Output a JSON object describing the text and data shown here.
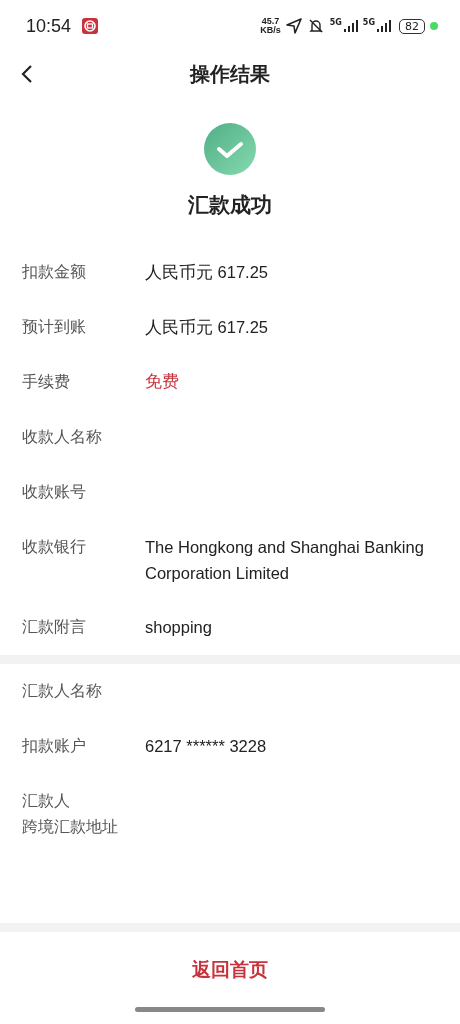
{
  "status_bar": {
    "time": "10:54",
    "speed": "45.7",
    "speed_unit": "KB/s",
    "network_1": "5G",
    "network_2": "5G",
    "battery": "82"
  },
  "nav": {
    "title": "操作结果"
  },
  "result": {
    "title": "汇款成功"
  },
  "sections": [
    {
      "rows": [
        {
          "label": "扣款金额",
          "value": "人民币元 617.25",
          "highlight": false
        },
        {
          "label": "预计到账",
          "value": "人民币元 617.25",
          "highlight": false
        },
        {
          "label": "手续费",
          "value": "免费",
          "highlight": true
        },
        {
          "label": "收款人名称"
        },
        {
          "label": "收款账号"
        },
        {
          "label": "收款银行",
          "value": "The Hongkong and Shanghai Banking Corporation Limited",
          "highlight": false
        },
        {
          "label": "汇款附言",
          "value": "shopping",
          "highlight": false
        }
      ]
    },
    {
      "rows": [
        {
          "label": "汇款人名称"
        },
        {
          "label": "扣款账户",
          "value": "6217 ****** 3228",
          "highlight": false
        },
        {
          "label": "汇款人",
          "label_2": "跨境汇款地址"
        }
      ]
    }
  ],
  "footer": {
    "button": "返回首页"
  }
}
